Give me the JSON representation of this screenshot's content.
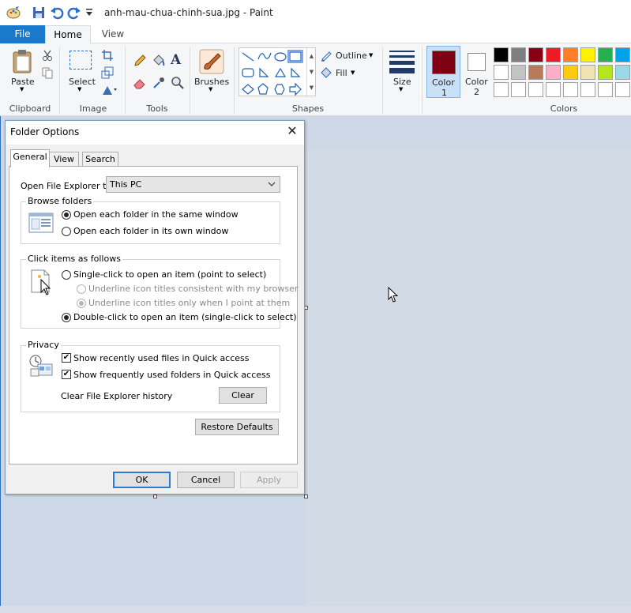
{
  "window": {
    "title": "anh-mau-chua-chinh-sua.jpg - Paint"
  },
  "menu": {
    "file": "File",
    "home": "Home",
    "view": "View"
  },
  "ribbon": {
    "clipboard": {
      "paste": "Paste",
      "group": "Clipboard"
    },
    "image": {
      "select": "Select",
      "group": "Image"
    },
    "tools": {
      "group": "Tools"
    },
    "brushes": {
      "label": "Brushes"
    },
    "shapes": {
      "outline": "Outline",
      "fill": "Fill",
      "group": "Shapes"
    },
    "size": {
      "label": "Size"
    },
    "color1": {
      "label": "Color",
      "num": "1",
      "value": "#800014"
    },
    "color2": {
      "label": "Color",
      "num": "2",
      "value": "#ffffff"
    },
    "colors": {
      "group": "Colors",
      "row1": [
        "#000000",
        "#7f7f7f",
        "#880015",
        "#ed1c24",
        "#ff7f27",
        "#fff200",
        "#22b14c",
        "#00a2e8"
      ],
      "row2": [
        "#ffffff",
        "#c3c3c3",
        "#b97a57",
        "#ffaec9",
        "#ffc90e",
        "#efe4b0",
        "#b5e61d",
        "#99d9ea"
      ],
      "row3": [
        "#ffffff",
        "#ffffff",
        "#ffffff",
        "#ffffff",
        "#ffffff",
        "#ffffff",
        "#ffffff",
        "#ffffff"
      ]
    }
  },
  "dialog": {
    "title": "Folder Options",
    "tabs": [
      "General",
      "View",
      "Search"
    ],
    "open_to_label": "Open File Explorer to:",
    "open_to_value": "This PC",
    "browse": {
      "title": "Browse folders",
      "same_window": "Open each folder in the same window",
      "own_window": "Open each folder in its own window"
    },
    "click": {
      "title": "Click items as follows",
      "single": "Single-click to open an item (point to select)",
      "underline_browser": "Underline icon titles consistent with my browser",
      "underline_point": "Underline icon titles only when I point at them",
      "double": "Double-click to open an item (single-click to select)"
    },
    "privacy": {
      "title": "Privacy",
      "recent_files": "Show recently used files in Quick access",
      "frequent_folders": "Show frequently used folders in Quick access",
      "clear_label": "Clear File Explorer history",
      "clear_button": "Clear"
    },
    "restore_defaults": "Restore Defaults",
    "ok": "OK",
    "cancel": "Cancel",
    "apply": "Apply"
  }
}
